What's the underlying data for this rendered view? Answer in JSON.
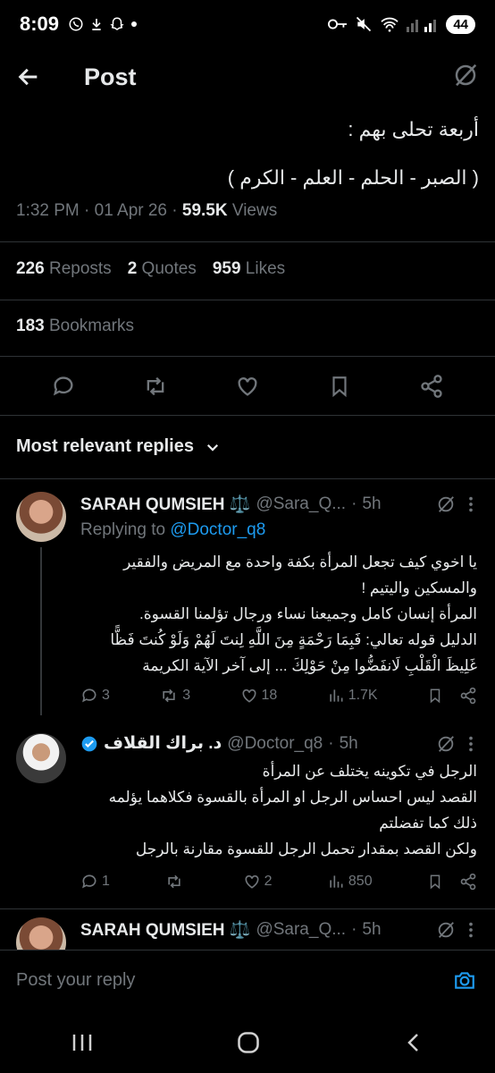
{
  "status": {
    "time": "8:09",
    "battery": "44"
  },
  "header": {
    "title": "Post"
  },
  "post": {
    "line1": "أربعة تحلى بهم :",
    "line2": "( الصبر - الحلم - العلم - الكرم )",
    "time": "1:32 PM",
    "date": "01 Apr 26",
    "views": "59.5K",
    "views_label": "Views",
    "reposts": "226",
    "reposts_label": "Reposts",
    "quotes": "2",
    "quotes_label": "Quotes",
    "likes": "959",
    "likes_label": "Likes",
    "bookmarks": "183",
    "bookmarks_label": "Bookmarks"
  },
  "sort": {
    "label": "Most relevant replies"
  },
  "replies": [
    {
      "name": "SARAH QUMSIEH ⚖️",
      "handle": "@Sara_Q...",
      "time": "5h",
      "replying_label": "Replying to",
      "replying_to": "@Doctor_q8",
      "lines": [
        "يا اخوي كيف تجعل المرأة بكفة واحدة مع المريض والفقير",
        "والمسكين واليتيم !",
        "المرأة إنسان كامل وجميعنا نساء ورجال تؤلمنا القسوة.",
        "الدليل قوله تعالي: فَبِمَا رَحْمَةٍ مِنَ اللَّهِ لِنتَ لَهُمْ وَلَوْ كُنتَ فَظًّا",
        "غَلِيظَ الْقَلْبِ لَانفَضُّوا مِنْ حَوْلِكَ ... إلى آخر الآية الكريمة"
      ],
      "replies": "3",
      "reposts": "3",
      "likes": "18",
      "views": "1.7K"
    },
    {
      "name": "د. براك القلاف",
      "handle": "@Doctor_q8",
      "time": "5h",
      "lines": [
        "الرجل في تكوينه يختلف عن المرأة",
        "القصد ليس احساس الرجل او المرأة بالقسوة فكلاهما يؤلمه",
        "ذلك كما تفضلتم",
        "ولكن القصد بمقدار تحمل الرجل للقسوة مقارنة بالرجل"
      ],
      "replies": "1",
      "reposts": "",
      "likes": "2",
      "views": "850"
    },
    {
      "name": "SARAH QUMSIEH ⚖️",
      "handle": "@Sara_Q...",
      "time": "5h"
    }
  ],
  "composer": {
    "placeholder": "Post your reply"
  },
  "colors": {
    "background": "#000000",
    "text": "#e7e9ea",
    "muted": "#71767b",
    "accent": "#1d9bf0"
  }
}
